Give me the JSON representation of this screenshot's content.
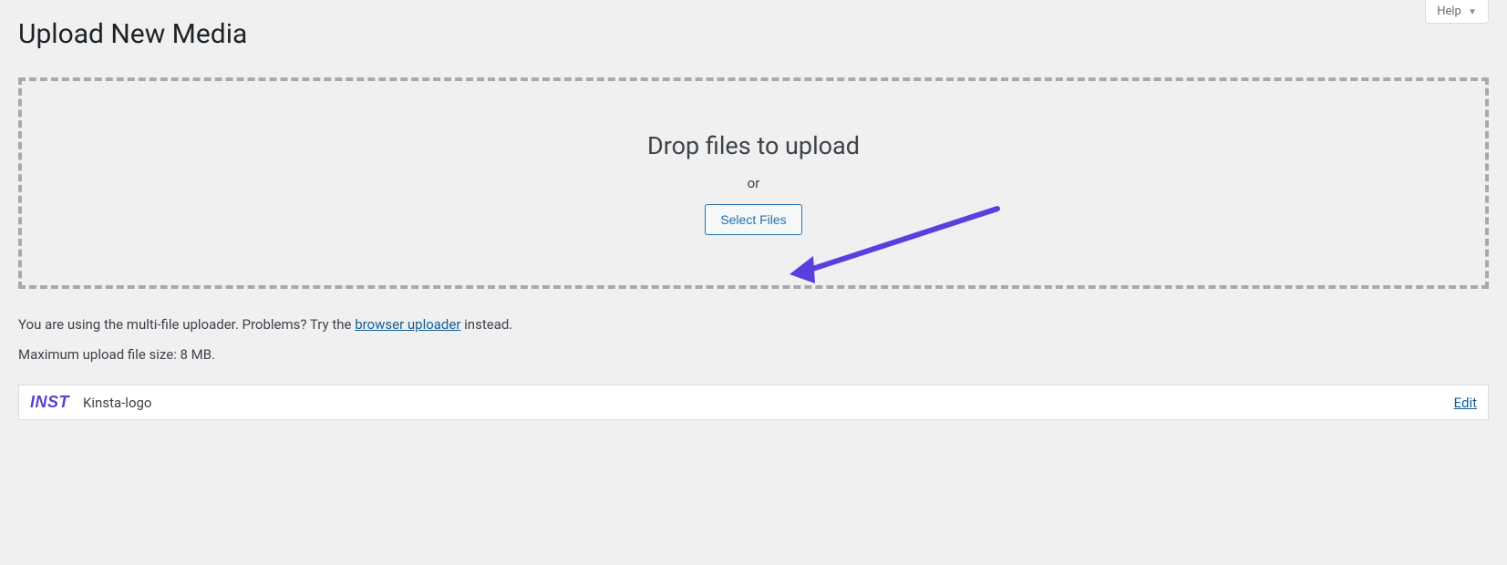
{
  "help_button": {
    "label": "Help"
  },
  "page": {
    "title": "Upload New Media"
  },
  "dropzone": {
    "title": "Drop files to upload",
    "or_text": "or",
    "select_button": "Select Files"
  },
  "info": {
    "uploader_prefix": "You are using the multi-file uploader. Problems? Try the ",
    "browser_uploader_link": "browser uploader",
    "uploader_suffix": " instead.",
    "max_size": "Maximum upload file size: 8 MB."
  },
  "media_item": {
    "thumb_text": "INST",
    "filename": "Kinsta-logo",
    "edit_label": "Edit"
  }
}
